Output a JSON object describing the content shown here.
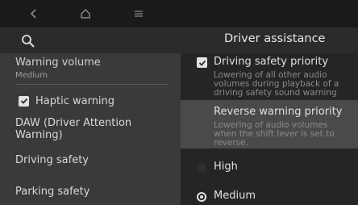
{
  "nav": {
    "back_icon": "chevron-left-icon",
    "home_icon": "home-icon",
    "menu_icon": "menu-icon"
  },
  "header": {
    "title": "Driver assistance",
    "search_icon": "search-icon"
  },
  "sidebar": {
    "warning_volume": {
      "label": "Warning volume",
      "value": "Medium"
    },
    "haptic": {
      "label": "Haptic warning",
      "checked": true
    },
    "items": [
      {
        "label": "DAW (Driver Attention Warning)"
      },
      {
        "label": "Driving safety"
      },
      {
        "label": "Parking safety"
      }
    ]
  },
  "options": {
    "driving_safety_priority": {
      "label": "Driving safety priority",
      "desc_lines": [
        "Lowering of all other audio",
        "volumes during playback of a",
        "driving safety sound warning"
      ],
      "checked": true
    },
    "reverse_warning_priority": {
      "label": "Reverse warning priority",
      "desc_lines": [
        "Lowering of audio volumes",
        "when the shift lever is set to",
        "reverse."
      ],
      "checked": false
    },
    "volume_levels": [
      {
        "label": "High",
        "selected": false
      },
      {
        "label": "Medium",
        "selected": true
      }
    ]
  },
  "colors": {
    "accent": "#e2e2e2",
    "highlight": "#4a4a4a"
  }
}
